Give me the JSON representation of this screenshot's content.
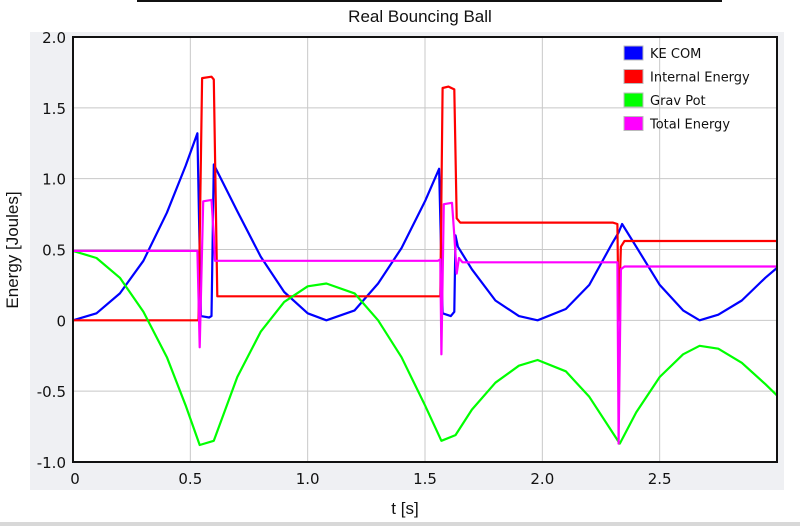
{
  "chart_data": {
    "type": "line",
    "title": "Real Bouncing Ball",
    "xlabel": "t [s]",
    "ylabel": "Energy [Joules]",
    "xlim": [
      0,
      3.0
    ],
    "ylim": [
      -1.0,
      2.0
    ],
    "xticks": [
      0,
      0.5,
      1.0,
      1.5,
      2.0,
      2.5
    ],
    "xtick_labels": [
      "0",
      "0.5",
      "1.0",
      "1.5",
      "2.0",
      "2.5"
    ],
    "yticks": [
      2.0,
      1.5,
      1.0,
      0.5,
      0,
      -0.5,
      -1.0
    ],
    "ytick_labels": [
      "2.0",
      "1.5",
      "1.0",
      "0.5",
      "0",
      "-0.5",
      "-1.0"
    ],
    "grid": true,
    "legend_position": "top-right",
    "series": [
      {
        "name": "KE COM",
        "color": "#0000ff",
        "points": [
          [
            0,
            0
          ],
          [
            0.1,
            0.05
          ],
          [
            0.2,
            0.19
          ],
          [
            0.3,
            0.42
          ],
          [
            0.4,
            0.76
          ],
          [
            0.48,
            1.09
          ],
          [
            0.53,
            1.32
          ],
          [
            0.545,
            0.03
          ],
          [
            0.58,
            0.02
          ],
          [
            0.59,
            0.03
          ],
          [
            0.6,
            1.1
          ],
          [
            0.7,
            0.77
          ],
          [
            0.8,
            0.45
          ],
          [
            0.9,
            0.2
          ],
          [
            1.0,
            0.05
          ],
          [
            1.08,
            0.0
          ],
          [
            1.2,
            0.07
          ],
          [
            1.3,
            0.26
          ],
          [
            1.4,
            0.51
          ],
          [
            1.5,
            0.84
          ],
          [
            1.56,
            1.07
          ],
          [
            1.575,
            0.05
          ],
          [
            1.61,
            0.03
          ],
          [
            1.625,
            0.06
          ],
          [
            1.63,
            0.6
          ],
          [
            1.64,
            0.52
          ],
          [
            1.7,
            0.36
          ],
          [
            1.8,
            0.14
          ],
          [
            1.9,
            0.03
          ],
          [
            1.98,
            0.0
          ],
          [
            2.1,
            0.08
          ],
          [
            2.2,
            0.25
          ],
          [
            2.3,
            0.55
          ],
          [
            2.325,
            0.62
          ],
          [
            2.34,
            0.68
          ],
          [
            2.4,
            0.52
          ],
          [
            2.5,
            0.25
          ],
          [
            2.6,
            0.07
          ],
          [
            2.67,
            0.0
          ],
          [
            2.75,
            0.04
          ],
          [
            2.85,
            0.14
          ],
          [
            2.95,
            0.3
          ],
          [
            3.0,
            0.37
          ]
        ]
      },
      {
        "name": "Internal Energy",
        "color": "#ff0000",
        "points": [
          [
            0,
            0
          ],
          [
            0.535,
            0
          ],
          [
            0.55,
            1.71
          ],
          [
            0.59,
            1.72
          ],
          [
            0.6,
            1.7
          ],
          [
            0.615,
            0.17
          ],
          [
            1.555,
            0.17
          ],
          [
            1.565,
            0.17
          ],
          [
            1.575,
            1.64
          ],
          [
            1.6,
            1.65
          ],
          [
            1.625,
            1.63
          ],
          [
            1.635,
            0.72
          ],
          [
            1.65,
            0.69
          ],
          [
            2.3,
            0.69
          ],
          [
            2.32,
            0.68
          ],
          [
            2.325,
            0.0
          ],
          [
            2.335,
            0.52
          ],
          [
            2.35,
            0.56
          ],
          [
            3.0,
            0.56
          ]
        ]
      },
      {
        "name": "Grav Pot",
        "color": "#00ff00",
        "points": [
          [
            0,
            0.49
          ],
          [
            0.1,
            0.44
          ],
          [
            0.2,
            0.3
          ],
          [
            0.3,
            0.06
          ],
          [
            0.4,
            -0.26
          ],
          [
            0.48,
            -0.6
          ],
          [
            0.54,
            -0.88
          ],
          [
            0.6,
            -0.85
          ],
          [
            0.7,
            -0.4
          ],
          [
            0.8,
            -0.08
          ],
          [
            0.9,
            0.13
          ],
          [
            1.0,
            0.24
          ],
          [
            1.08,
            0.26
          ],
          [
            1.2,
            0.19
          ],
          [
            1.3,
            0.0
          ],
          [
            1.4,
            -0.26
          ],
          [
            1.5,
            -0.6
          ],
          [
            1.57,
            -0.85
          ],
          [
            1.63,
            -0.81
          ],
          [
            1.7,
            -0.63
          ],
          [
            1.8,
            -0.44
          ],
          [
            1.9,
            -0.32
          ],
          [
            1.98,
            -0.28
          ],
          [
            2.1,
            -0.36
          ],
          [
            2.2,
            -0.54
          ],
          [
            2.33,
            -0.87
          ],
          [
            2.4,
            -0.65
          ],
          [
            2.5,
            -0.4
          ],
          [
            2.6,
            -0.24
          ],
          [
            2.67,
            -0.18
          ],
          [
            2.75,
            -0.2
          ],
          [
            2.85,
            -0.3
          ],
          [
            2.95,
            -0.45
          ],
          [
            3.0,
            -0.53
          ]
        ]
      },
      {
        "name": "Total Energy",
        "color": "#ff00ff",
        "points": [
          [
            0,
            0.49
          ],
          [
            0.53,
            0.49
          ],
          [
            0.54,
            -0.19
          ],
          [
            0.555,
            0.84
          ],
          [
            0.59,
            0.85
          ],
          [
            0.6,
            0.6
          ],
          [
            0.605,
            0.42
          ],
          [
            1.555,
            0.42
          ],
          [
            1.565,
            0.43
          ],
          [
            1.57,
            -0.24
          ],
          [
            1.58,
            0.82
          ],
          [
            1.615,
            0.83
          ],
          [
            1.625,
            0.6
          ],
          [
            1.635,
            0.33
          ],
          [
            1.645,
            0.44
          ],
          [
            1.66,
            0.41
          ],
          [
            2.32,
            0.41
          ],
          [
            2.325,
            -0.87
          ],
          [
            2.335,
            0.36
          ],
          [
            2.35,
            0.38
          ],
          [
            3.0,
            0.38
          ]
        ]
      }
    ]
  }
}
